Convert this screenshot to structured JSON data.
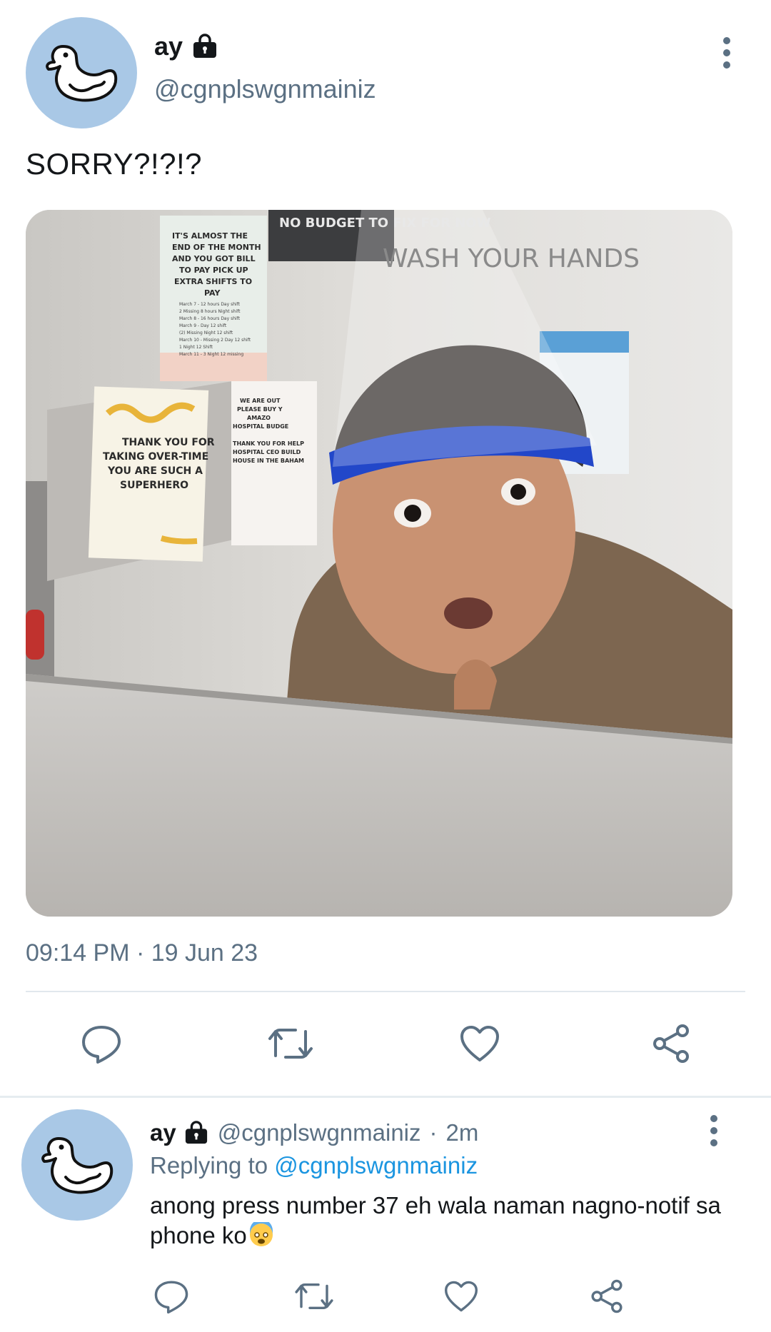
{
  "tweet": {
    "display_name": "ay",
    "handle": "@cgnplswgnmainiz",
    "text": "SORRY?!?!?",
    "media_text": {
      "sign_top": "NO BUDGET TO FIX FOR NOW",
      "sign_wash": "WASH YOUR HANDS",
      "note_1": [
        "IT'S ALMOST THE",
        "END OF THE MONTH",
        "AND YOU GOT BILL",
        "TO PAY PICK UP",
        "EXTRA SHIFTS TO",
        "PAY"
      ],
      "note_1_small": [
        "March 7 - 12 hours Day shift",
        "2 Missing 8 hours Night shift",
        "March 8 - 16 hours Day shift",
        "March 9 - Day 12 shift",
        "(2) Missing Night 12 shift",
        "March 10 - Missing 2 Day 12 shift",
        "1 Night 12 Shift",
        "March 11 - 3 Night 12 missing"
      ],
      "note_2": [
        "THANK YOU FOR",
        "TAKING OVER-TIME",
        "YOU ARE SUCH A",
        "SUPERHERO"
      ],
      "note_3": [
        "WE ARE OUT",
        "PLEASE BUY Y",
        "AMAZO",
        "HOSPITAL BUDGE",
        "THANK YOU FOR HELP",
        "HOSPITAL CEO BUILD",
        "HOUSE IN THE BAHAM"
      ]
    },
    "timestamp": "09:14 PM · 19 Jun 23",
    "actions": [
      "reply-icon",
      "retweet-icon",
      "like-icon",
      "share-icon"
    ]
  },
  "reply": {
    "display_name": "ay",
    "handle": "@cgnplswgnmainiz",
    "separator": "·",
    "time": "2m",
    "replying_prefix": "Replying to",
    "replying_to": "@cgnplswgnmainiz",
    "text": "anong press number 37 eh wala naman nagno-notif sa phone ko",
    "emoji": "😨",
    "actions": [
      "reply-icon",
      "retweet-icon",
      "like-icon",
      "share-icon"
    ]
  },
  "colors": {
    "avatar_bg": "#a9c8e6",
    "secondary_text": "#5b7083",
    "link": "#1b95e0",
    "divider": "#e1e8ed"
  }
}
